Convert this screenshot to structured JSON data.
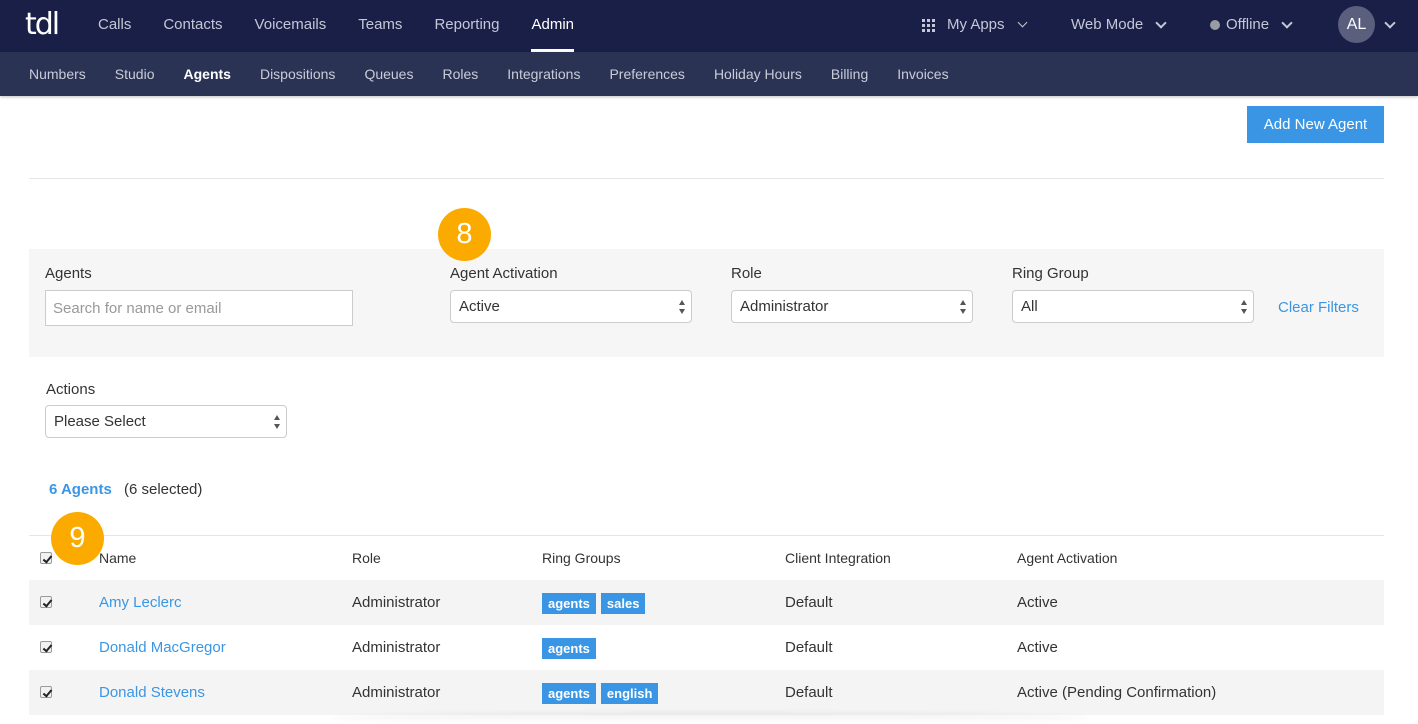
{
  "app": {
    "logo_text": "tdl"
  },
  "top_nav": {
    "items": [
      {
        "label": "Calls",
        "active": false
      },
      {
        "label": "Contacts",
        "active": false
      },
      {
        "label": "Voicemails",
        "active": false
      },
      {
        "label": "Teams",
        "active": false
      },
      {
        "label": "Reporting",
        "active": false
      },
      {
        "label": "Admin",
        "active": true
      }
    ],
    "my_apps": {
      "label": "My Apps",
      "icon": "grid-icon"
    },
    "web_mode": {
      "label": "Web Mode"
    },
    "status": {
      "label": "Offline",
      "dot_color": "#9a9ca4"
    },
    "user": {
      "initials": "AL"
    }
  },
  "sub_nav": {
    "items": [
      {
        "label": "Numbers",
        "active": false
      },
      {
        "label": "Studio",
        "active": false
      },
      {
        "label": "Agents",
        "active": true
      },
      {
        "label": "Dispositions",
        "active": false
      },
      {
        "label": "Queues",
        "active": false
      },
      {
        "label": "Roles",
        "active": false
      },
      {
        "label": "Integrations",
        "active": false
      },
      {
        "label": "Preferences",
        "active": false
      },
      {
        "label": "Holiday Hours",
        "active": false
      },
      {
        "label": "Billing",
        "active": false
      },
      {
        "label": "Invoices",
        "active": false
      }
    ]
  },
  "toolbar": {
    "add_agent_label": "Add New Agent"
  },
  "steps": {
    "step8": "8",
    "step9": "9"
  },
  "filters": {
    "agents": {
      "label": "Agents",
      "value": "",
      "placeholder": "Search for name or email"
    },
    "agent_activation": {
      "label": "Agent Activation",
      "value": "Active"
    },
    "role": {
      "label": "Role",
      "value": "Administrator"
    },
    "ring_group": {
      "label": "Ring Group",
      "value": "All"
    },
    "clear_label": "Clear Filters"
  },
  "actions": {
    "label": "Actions",
    "value": "Please Select"
  },
  "summary": {
    "count_label": "6 Agents",
    "selected_label": "(6 selected)"
  },
  "table": {
    "headers": [
      "Name",
      "Role",
      "Ring Groups",
      "Client Integration",
      "Agent Activation"
    ],
    "header_checked": true,
    "rows": [
      {
        "checked": true,
        "name": "Amy Leclerc",
        "role": "Administrator",
        "ring_groups": [
          "agents",
          "sales"
        ],
        "client_integration": "Default",
        "activation": "Active"
      },
      {
        "checked": true,
        "name": "Donald MacGregor",
        "role": "Administrator",
        "ring_groups": [
          "agents"
        ],
        "client_integration": "Default",
        "activation": "Active"
      },
      {
        "checked": true,
        "name": "Donald Stevens",
        "role": "Administrator",
        "ring_groups": [
          "agents",
          "english"
        ],
        "client_integration": "Default",
        "activation": "Active (Pending Confirmation)"
      }
    ]
  },
  "colors": {
    "topbar": "#1a1f48",
    "subbar": "#2a3354",
    "accent": "#3a96e4",
    "badge": "#fbab00"
  }
}
